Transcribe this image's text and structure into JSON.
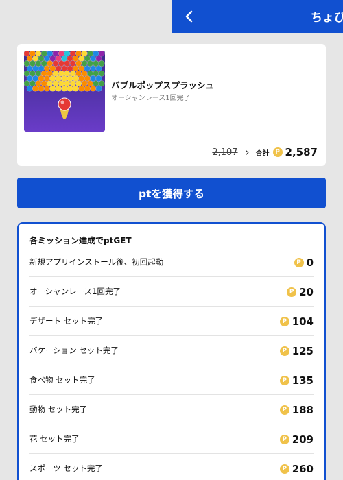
{
  "header": {
    "title": "ちょび",
    "back_icon": "chevron-left-icon",
    "color": "#1150d0"
  },
  "app": {
    "name": "バブルポップスプラッシュ",
    "description": "オーシャンレース1回完了",
    "old_points": "2,107",
    "total_label": "合計",
    "coin_symbol": "P",
    "total_points": "2,587"
  },
  "get_button": {
    "label": "ptを獲得する"
  },
  "missions": {
    "heading": "各ミッション達成でptGET",
    "items": [
      {
        "label": "新規アプリインストール後、初回起動",
        "points": "0"
      },
      {
        "label": "オーシャンレース1回完了",
        "points": "20"
      },
      {
        "label": "デザート セット完了",
        "points": "104"
      },
      {
        "label": "バケーション セット完了",
        "points": "125"
      },
      {
        "label": "食べ物 セット完了",
        "points": "135"
      },
      {
        "label": "動物 セット完了",
        "points": "188"
      },
      {
        "label": "花 セット完了",
        "points": "209"
      },
      {
        "label": "スポーツ セット完了",
        "points": "260"
      }
    ]
  },
  "colors": {
    "accent": "#1150d0",
    "coin": "#f0c24a",
    "background": "#e6e6e6"
  }
}
